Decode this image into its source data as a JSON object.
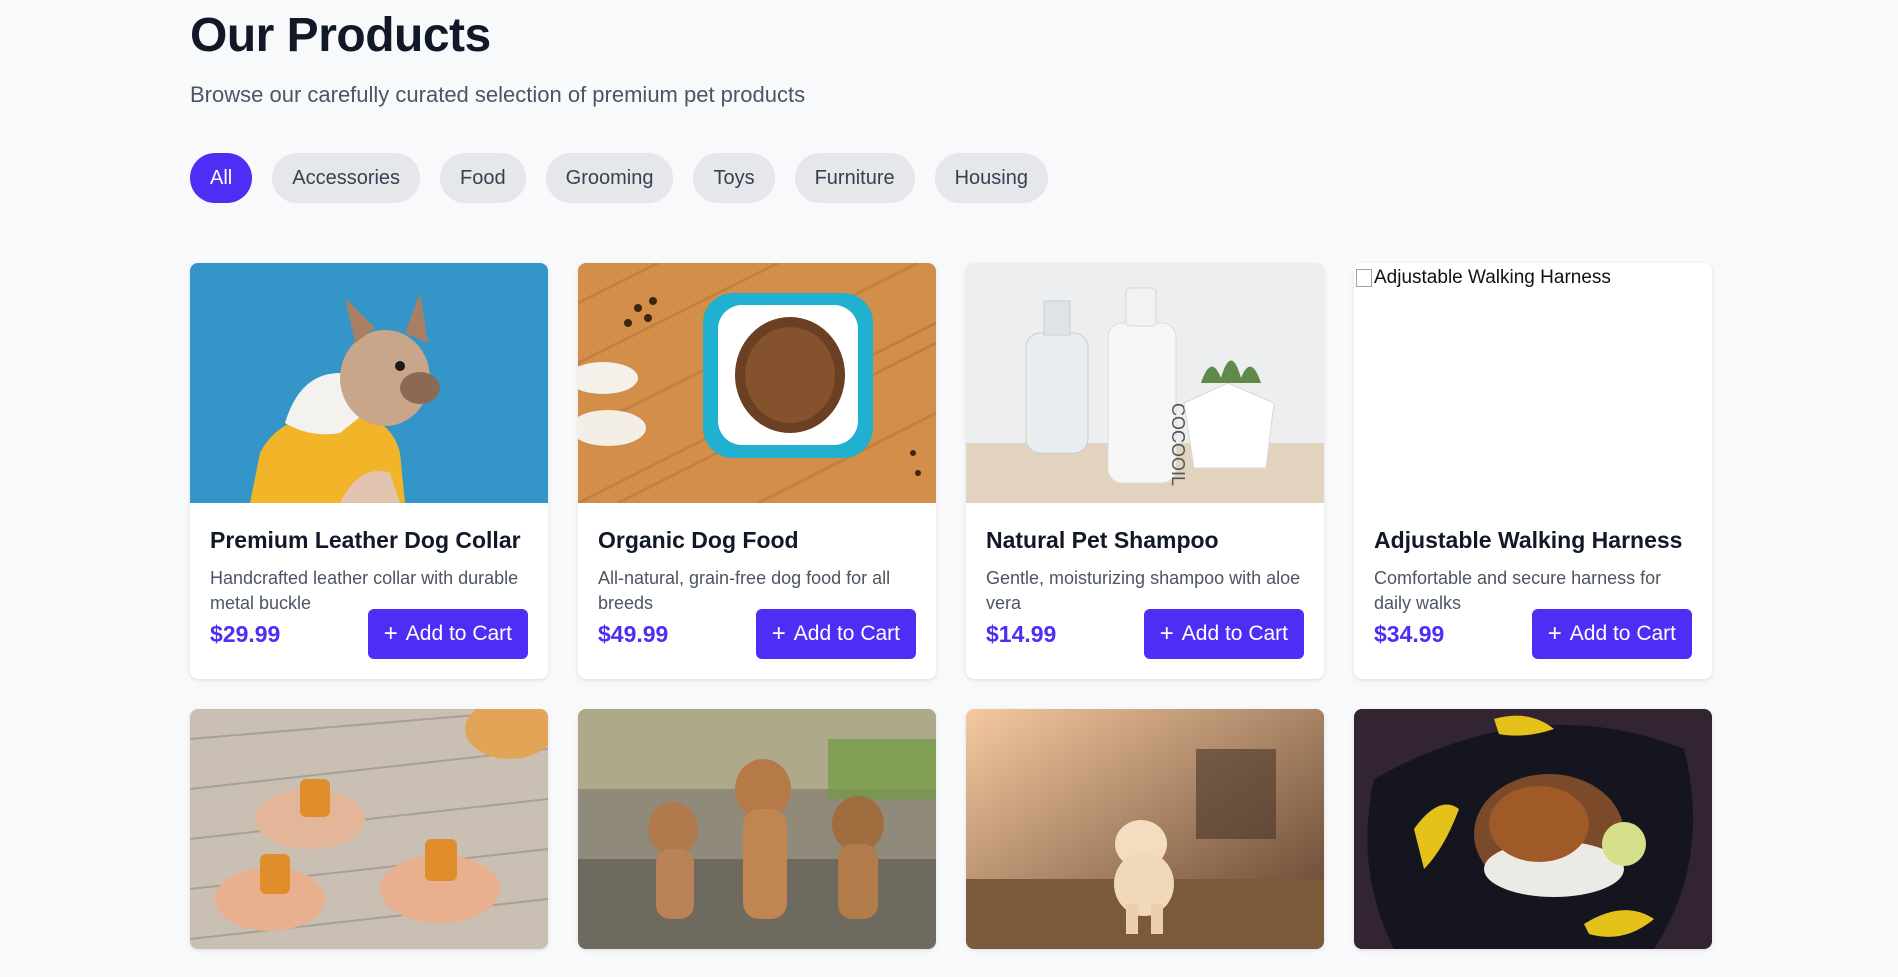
{
  "header": {
    "title": "Our Products",
    "subtitle": "Browse our carefully curated selection of premium pet products"
  },
  "filters": [
    "All",
    "Accessories",
    "Food",
    "Grooming",
    "Toys",
    "Furniture",
    "Housing"
  ],
  "active_filter": "All",
  "add_to_cart_label": "Add to Cart",
  "products": [
    {
      "name": "Premium Leather Dog Collar",
      "description": "Handcrafted leather collar with durable metal buckle",
      "price": "$29.99",
      "image": "dog-in-yellow-hoodie"
    },
    {
      "name": "Organic Dog Food",
      "description": "All-natural, grain-free dog food for all breeds",
      "price": "$49.99",
      "image": "dog-food-bowl"
    },
    {
      "name": "Natural Pet Shampoo",
      "description": "Gentle, moisturizing shampoo with aloe vera",
      "price": "$14.99",
      "image": "shampoo-bottles",
      "bottle_text": "COCOOIL"
    },
    {
      "name": "Adjustable Walking Harness",
      "description": "Comfortable and secure harness for daily walks",
      "price": "$34.99",
      "image": "broken",
      "alt": "Adjustable Walking Harness"
    }
  ],
  "row2_images": [
    "dog-treats",
    "three-puppies",
    "running-puppy",
    "plated-food"
  ],
  "colors": {
    "accent": "#4f2df5",
    "chip_bg": "#e5e7eb",
    "page_bg": "#f8f9fb"
  }
}
